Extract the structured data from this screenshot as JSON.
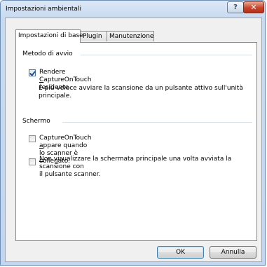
{
  "window": {
    "title": "Impostazioni ambientali",
    "help_glyph": "?",
    "close_glyph": "✕"
  },
  "tabs": [
    {
      "label": "Impostazioni di base",
      "active": true
    },
    {
      "label": "Plugin",
      "active": false
    },
    {
      "label": "Manutenzione",
      "active": false
    }
  ],
  "startup": {
    "group_title": "Metodo di avvio",
    "resident_checkbox": {
      "checked": true,
      "label_pre": "Rendere ",
      "label_mnemonic": "C",
      "label_post": "aptureOnTouch residente"
    },
    "description_line1": "È più veloce avviare la scansione da un pulsante attivo sull'unità",
    "description_line2": "principale."
  },
  "screen": {
    "group_title": "Schermo",
    "appear_checkbox": {
      "checked": false,
      "label_pre": "CaptureOnTouch ",
      "label_mnemonic": "a",
      "label_post": "ppare quando lo scanner è collegato."
    },
    "hide_main_checkbox": {
      "checked": false,
      "label_mnemonic": "N",
      "label_line1_post": "on visualizzare la schermata principale una volta avviata la scansione con",
      "label_line2": "il pulsante scanner."
    }
  },
  "buttons": {
    "ok": "OK",
    "cancel": "Annulla"
  }
}
